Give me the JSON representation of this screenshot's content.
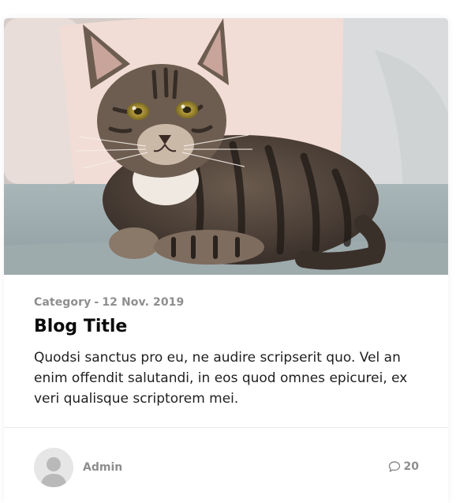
{
  "post": {
    "category": "Category",
    "separator": "-",
    "date": "12 Nov. 2019",
    "title": "Blog Title",
    "excerpt": "Quodsi sanctus pro eu, ne audire scripserit quo. Vel an enim offendit salutandi, in eos quod omnes epicurei, ex veri qualisque scriptorem mei."
  },
  "author": {
    "name": "Admin",
    "avatar_icon": "user-silhouette-icon"
  },
  "comments": {
    "icon": "comment-bubble-icon",
    "count": "20"
  },
  "image": {
    "subject": "tabby-cat-on-sofa"
  },
  "colors": {
    "meta_text": "#8e8e8e",
    "title_text": "#0a0a0a",
    "body_text": "#1f1f1f",
    "divider": "#e9e9e9",
    "avatar_bg": "#e6e6e6"
  }
}
